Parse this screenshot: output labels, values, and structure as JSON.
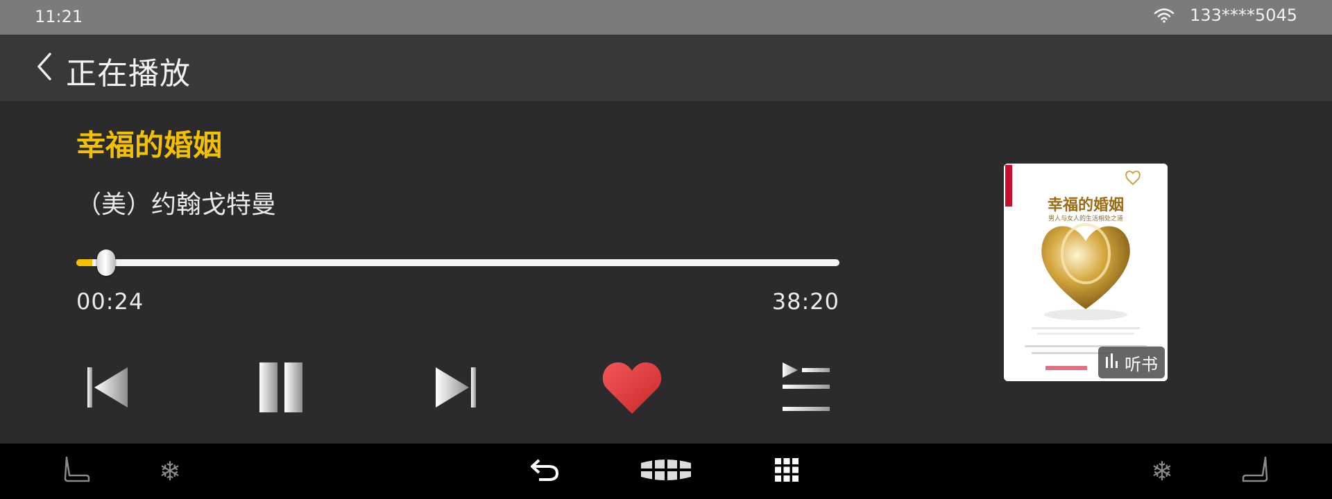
{
  "status_bar": {
    "time": "11:21",
    "account": "133****5045",
    "wifi_icon": "wifi-icon"
  },
  "header": {
    "back_icon": "chevron-left-icon",
    "title": "正在播放"
  },
  "player": {
    "book_title": "幸福的婚姻",
    "author": "（美）约翰戈特曼",
    "elapsed": "00:24",
    "duration": "38:20",
    "progress_fraction": 0.0104,
    "accent_color": "#f3c000",
    "favorite_color": "#e8393a",
    "controls": [
      {
        "name": "previous",
        "icon": "skip-previous-icon"
      },
      {
        "name": "pause",
        "icon": "pause-icon"
      },
      {
        "name": "next",
        "icon": "skip-next-icon"
      },
      {
        "name": "favorite",
        "icon": "heart-icon"
      },
      {
        "name": "playlist",
        "icon": "playlist-icon"
      }
    ]
  },
  "cover": {
    "title": "幸福的婚姻",
    "subtitle": "男人与女人的生活相处之道",
    "badge_label": "听书",
    "badge_icon": "audio-bars-icon"
  },
  "dock": {
    "items": [
      {
        "icon": "seat-left-icon"
      },
      {
        "icon": "snowflake-left-icon"
      },
      {
        "icon": "return-icon"
      },
      {
        "icon": "brand-logo-icon"
      },
      {
        "icon": "app-grid-icon"
      },
      {
        "icon": "snowflake-right-icon"
      },
      {
        "icon": "seat-right-icon"
      }
    ]
  }
}
